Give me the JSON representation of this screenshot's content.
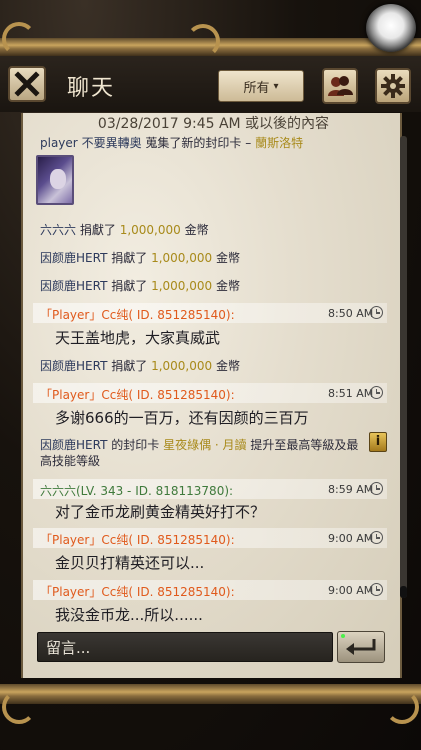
{
  "header": {
    "title": "聊天",
    "filter_label": "所有",
    "filter_arrow": "▾"
  },
  "chat": {
    "date_line": "03/28/2017  9:45 AM 或以後的內容",
    "entries": [
      {
        "player": "player",
        "pre": "不要異轉奧",
        "action": "蒐集了新的封印卡 –",
        "card": "蘭斯洛特"
      },
      {
        "player": "六六六",
        "action": "捐獻了",
        "amount": "1,000,000",
        "unit": "金幣"
      },
      {
        "player": "因颜鹿HERT",
        "action": "捐獻了",
        "amount": "1,000,000",
        "unit": "金幣"
      },
      {
        "player": "因颜鹿HERT",
        "action": "捐獻了",
        "amount": "1,000,000",
        "unit": "金幣"
      },
      {
        "sender": "「Player」Cc纯( ID. 851285140):",
        "time": "8:50 AM",
        "text": "天王盖地虎，大家真威武"
      },
      {
        "player": "因颜鹿HERT",
        "action": "捐獻了",
        "amount": "1,000,000",
        "unit": "金幣"
      },
      {
        "sender": "「Player」Cc纯( ID. 851285140):",
        "time": "8:51 AM",
        "text": "多谢666的一百万，还有因颜的三百万"
      },
      {
        "player": "因颜鹿HERT",
        "action": "的封印卡",
        "card": "星夜綠偶 · 月讀",
        "rest": "提升至最高等級及最",
        "rest2": "高技能等級"
      },
      {
        "sender": "六六六(LV. 343 - ID. 818113780):",
        "time": "8:59 AM",
        "text": "对了金币龙刷黄金精英好打不？"
      },
      {
        "sender": "「Player」Cc纯( ID. 851285140):",
        "time": "9:00 AM",
        "text": "金贝贝打精英还可以..."
      },
      {
        "sender": "「Player」Cc纯( ID. 851285140):",
        "time": "9:00 AM",
        "text": "我没金币龙...所以......"
      }
    ]
  },
  "input": {
    "placeholder": "留言..."
  },
  "icons": {
    "close": "close-icon",
    "friends": "friends-icon",
    "settings": "gear-icon",
    "send": "return-arrow-icon",
    "clock": "clock-icon",
    "info": "info-icon"
  },
  "colors": {
    "system_name": "#2d3a5c",
    "gold_amount": "#a88a1a",
    "player_orange": "#e05a1c",
    "level_green": "#3f7a3c",
    "parchment": "#e4ddcd"
  }
}
